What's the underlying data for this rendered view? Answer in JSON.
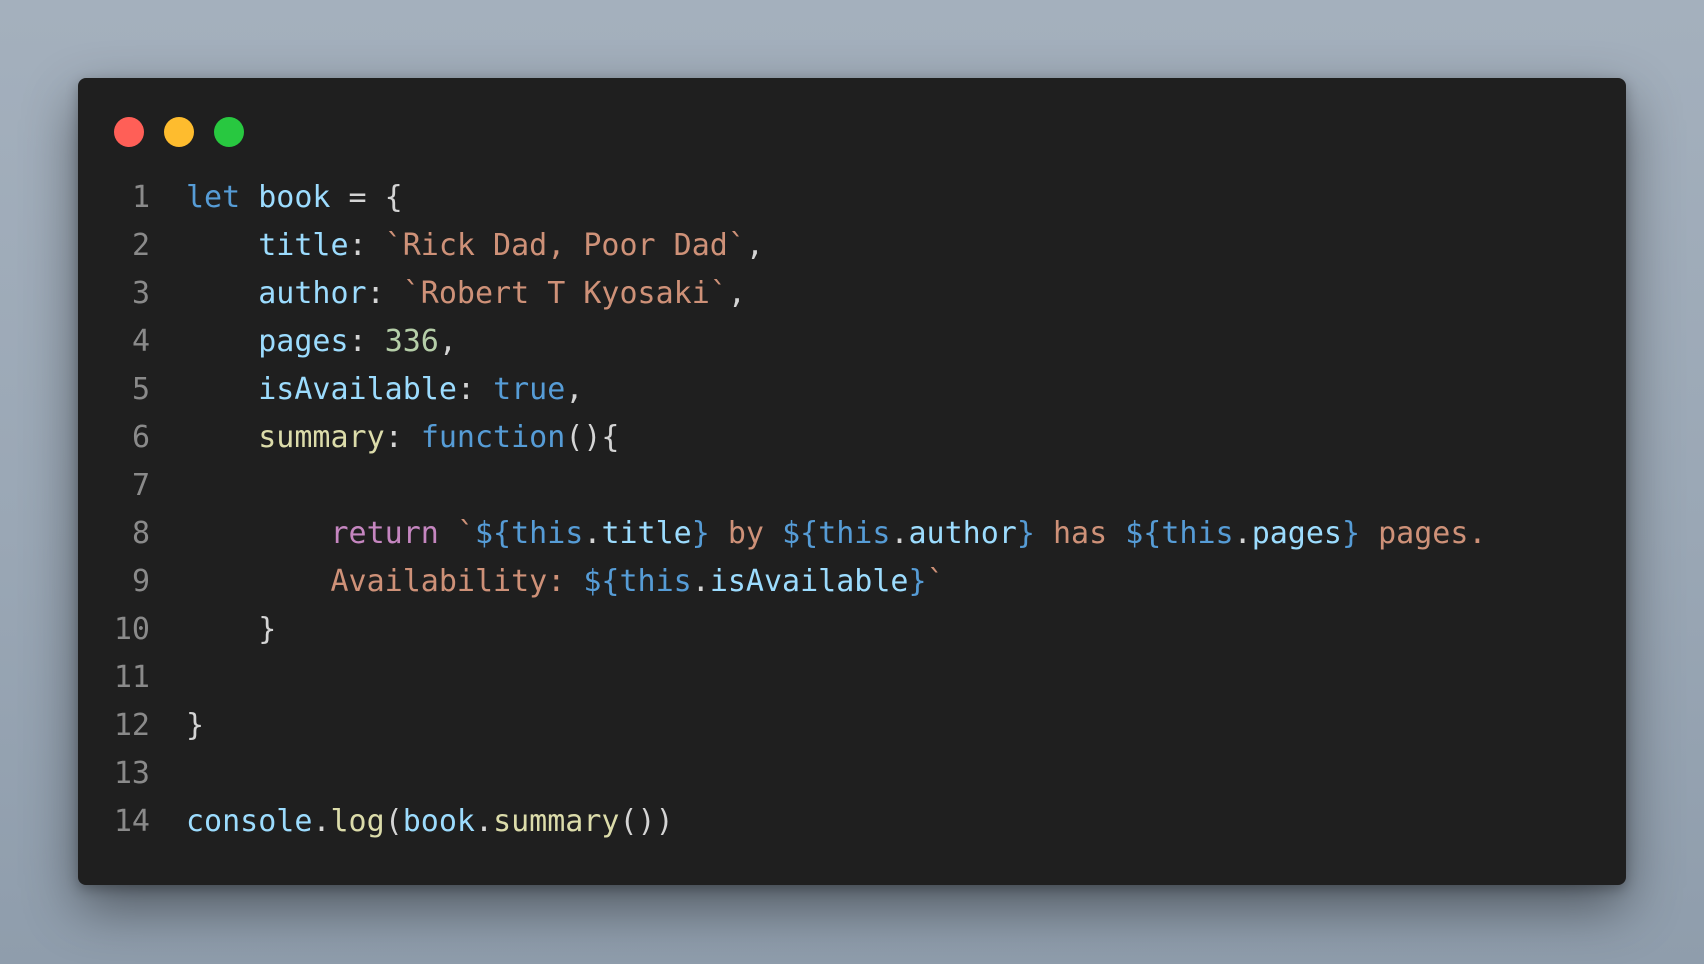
{
  "colors": {
    "background": "#a4b0bd",
    "window": "#1f1f1f",
    "line_number": "#8a8a8a",
    "keyword": "#569cd6",
    "variable": "#9cdcfe",
    "string": "#ce9178",
    "number": "#b5cea8",
    "function": "#dcdcaa",
    "control": "#c586c0",
    "punctuation": "#d4d4d4"
  },
  "window_controls": [
    {
      "name": "close",
      "color": "#ff5f57"
    },
    {
      "name": "minimize",
      "color": "#febc2e"
    },
    {
      "name": "maximize",
      "color": "#28c840"
    }
  ],
  "code_lines": [
    {
      "num": "1",
      "tokens": [
        {
          "t": "let",
          "c": "keyword"
        },
        {
          "t": " ",
          "c": "punctuation"
        },
        {
          "t": "book",
          "c": "variable"
        },
        {
          "t": " = {",
          "c": "punctuation"
        }
      ]
    },
    {
      "num": "2",
      "tokens": [
        {
          "t": "    ",
          "c": "punctuation"
        },
        {
          "t": "title",
          "c": "variable"
        },
        {
          "t": ": ",
          "c": "punctuation"
        },
        {
          "t": "`Rick Dad, Poor Dad`",
          "c": "string"
        },
        {
          "t": ",",
          "c": "punctuation"
        }
      ]
    },
    {
      "num": "3",
      "tokens": [
        {
          "t": "    ",
          "c": "punctuation"
        },
        {
          "t": "author",
          "c": "variable"
        },
        {
          "t": ": ",
          "c": "punctuation"
        },
        {
          "t": "`Robert T Kyosaki`",
          "c": "string"
        },
        {
          "t": ",",
          "c": "punctuation"
        }
      ]
    },
    {
      "num": "4",
      "tokens": [
        {
          "t": "    ",
          "c": "punctuation"
        },
        {
          "t": "pages",
          "c": "variable"
        },
        {
          "t": ": ",
          "c": "punctuation"
        },
        {
          "t": "336",
          "c": "number"
        },
        {
          "t": ",",
          "c": "punctuation"
        }
      ]
    },
    {
      "num": "5",
      "tokens": [
        {
          "t": "    ",
          "c": "punctuation"
        },
        {
          "t": "isAvailable",
          "c": "variable"
        },
        {
          "t": ": ",
          "c": "punctuation"
        },
        {
          "t": "true",
          "c": "keyword"
        },
        {
          "t": ",",
          "c": "punctuation"
        }
      ]
    },
    {
      "num": "6",
      "tokens": [
        {
          "t": "    ",
          "c": "punctuation"
        },
        {
          "t": "summary",
          "c": "function"
        },
        {
          "t": ": ",
          "c": "punctuation"
        },
        {
          "t": "function",
          "c": "keyword"
        },
        {
          "t": "(){",
          "c": "punctuation"
        }
      ]
    },
    {
      "num": "7",
      "tokens": []
    },
    {
      "num": "8",
      "tokens": [
        {
          "t": "        ",
          "c": "punctuation"
        },
        {
          "t": "return",
          "c": "control"
        },
        {
          "t": " ",
          "c": "punctuation"
        },
        {
          "t": "`",
          "c": "string"
        },
        {
          "t": "${",
          "c": "keyword"
        },
        {
          "t": "this",
          "c": "keyword"
        },
        {
          "t": ".",
          "c": "punctuation"
        },
        {
          "t": "title",
          "c": "variable"
        },
        {
          "t": "}",
          "c": "keyword"
        },
        {
          "t": " by ",
          "c": "string"
        },
        {
          "t": "${",
          "c": "keyword"
        },
        {
          "t": "this",
          "c": "keyword"
        },
        {
          "t": ".",
          "c": "punctuation"
        },
        {
          "t": "author",
          "c": "variable"
        },
        {
          "t": "}",
          "c": "keyword"
        },
        {
          "t": " has ",
          "c": "string"
        },
        {
          "t": "${",
          "c": "keyword"
        },
        {
          "t": "this",
          "c": "keyword"
        },
        {
          "t": ".",
          "c": "punctuation"
        },
        {
          "t": "pages",
          "c": "variable"
        },
        {
          "t": "}",
          "c": "keyword"
        },
        {
          "t": " pages.",
          "c": "string"
        }
      ]
    },
    {
      "num": "9",
      "tokens": [
        {
          "t": "        ",
          "c": "punctuation"
        },
        {
          "t": "Availability: ",
          "c": "string"
        },
        {
          "t": "${",
          "c": "keyword"
        },
        {
          "t": "this",
          "c": "keyword"
        },
        {
          "t": ".",
          "c": "punctuation"
        },
        {
          "t": "isAvailable",
          "c": "variable"
        },
        {
          "t": "}",
          "c": "keyword"
        },
        {
          "t": "`",
          "c": "string"
        }
      ]
    },
    {
      "num": "10",
      "tokens": [
        {
          "t": "    }",
          "c": "punctuation"
        }
      ]
    },
    {
      "num": "11",
      "tokens": []
    },
    {
      "num": "12",
      "tokens": [
        {
          "t": "}",
          "c": "punctuation"
        }
      ]
    },
    {
      "num": "13",
      "tokens": []
    },
    {
      "num": "14",
      "tokens": [
        {
          "t": "console",
          "c": "variable"
        },
        {
          "t": ".",
          "c": "punctuation"
        },
        {
          "t": "log",
          "c": "function"
        },
        {
          "t": "(",
          "c": "punctuation"
        },
        {
          "t": "book",
          "c": "variable"
        },
        {
          "t": ".",
          "c": "punctuation"
        },
        {
          "t": "summary",
          "c": "function"
        },
        {
          "t": "())",
          "c": "punctuation"
        }
      ]
    }
  ]
}
